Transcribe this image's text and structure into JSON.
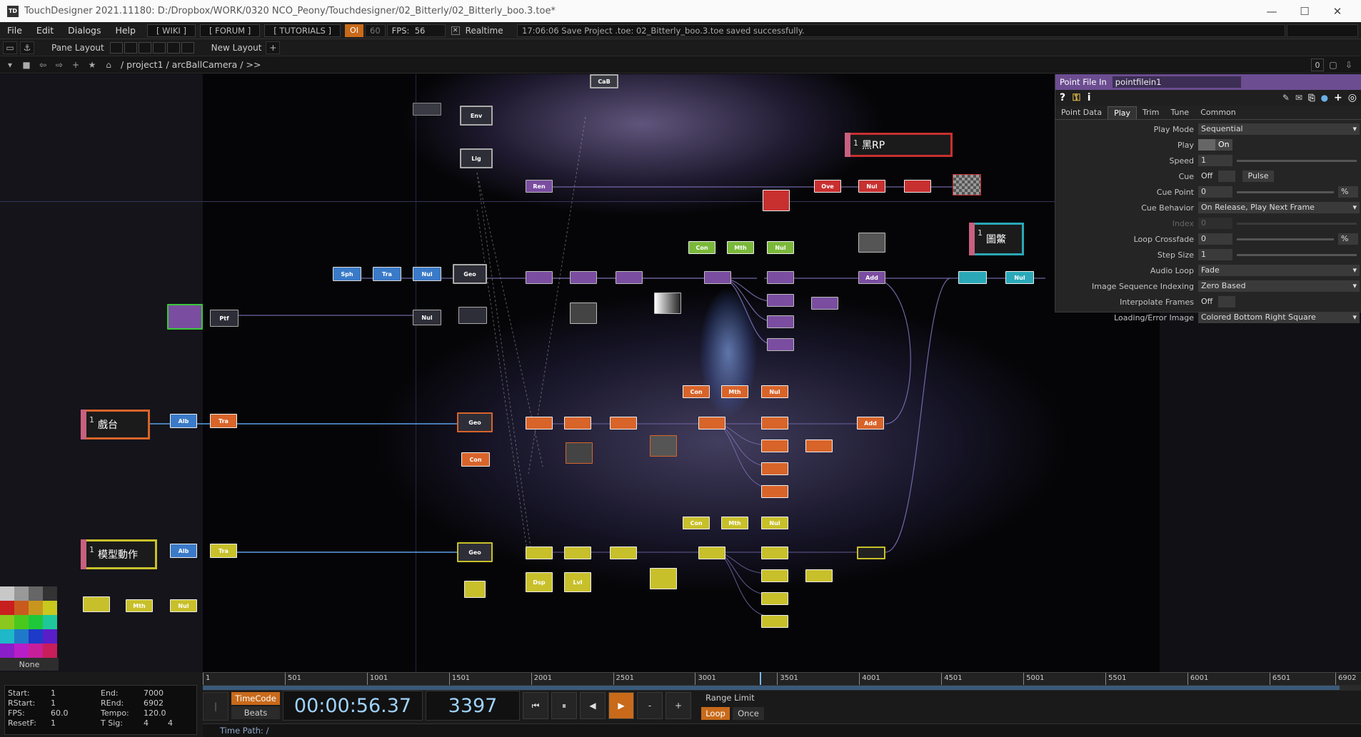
{
  "window": {
    "title": "TouchDesigner 2021.11180: D:/Dropbox/WORK/0320 NCO_Peony/Touchdesigner/02_Bitterly/02_Bitterly_boo.3.toe*",
    "app_badge": "TD",
    "minimize": "—",
    "maximize": "☐",
    "close": "✕"
  },
  "menu": {
    "items": [
      "File",
      "Edit",
      "Dialogs",
      "Help"
    ],
    "wiki": "[ WIKI ]",
    "forum": "[ FORUM ]",
    "tutorials": "[ TUTORIALS ]",
    "oi": "OI",
    "fps_target": "60",
    "fps_label": "FPS:",
    "fps_value": "56",
    "realtime_label": "Realtime",
    "realtime_check": "✕",
    "status_message": "17:06:06 Save Project .toe: 02_Bitterly_boo.3.toe saved successfully."
  },
  "toolbar": {
    "pane_layout": "Pane Layout",
    "new_layout": "New Layout",
    "add": "+"
  },
  "pathbar": {
    "path": "/ project1 / arcBallCamera / >>",
    "counter": "0"
  },
  "network": {
    "nodes": [
      {
        "id": "cab",
        "label": "CaB",
        "color": "#666a78"
      },
      {
        "id": "env",
        "label": "Env",
        "color": "#666a78"
      },
      {
        "id": "lig",
        "label": "Lig",
        "color": "#666a78"
      },
      {
        "id": "ren1",
        "label": "Ren",
        "color": "#7a4da0"
      },
      {
        "id": "ove",
        "label": "Ove",
        "color": "#c83030"
      },
      {
        "id": "nul_r1",
        "label": "Nul",
        "color": "#c83030"
      },
      {
        "id": "sph",
        "label": "Sph",
        "color": "#3a7ac8"
      },
      {
        "id": "tra1",
        "label": "Tra",
        "color": "#3a7ac8"
      },
      {
        "id": "nul_b1",
        "label": "Nul",
        "color": "#3a7ac8"
      },
      {
        "id": "geo1",
        "label": "Geo",
        "color": "#666a78"
      },
      {
        "id": "ptf",
        "label": "Ptf",
        "color": "#7a4da0"
      },
      {
        "id": "nul_p1",
        "label": "Nul",
        "color": "#7a4da0"
      },
      {
        "id": "con1",
        "label": "Con",
        "color": "#7ab83a"
      },
      {
        "id": "mth1",
        "label": "Mth",
        "color": "#7ab83a"
      },
      {
        "id": "nul_g1",
        "label": "Nul",
        "color": "#7ab83a"
      },
      {
        "id": "add1",
        "label": "Add",
        "color": "#7a4da0"
      },
      {
        "id": "nul_c1",
        "label": "Nul",
        "color": "#2aa8b8"
      },
      {
        "id": "alb1",
        "label": "Alb",
        "color": "#3a7ac8"
      },
      {
        "id": "tra2",
        "label": "Tra",
        "color": "#d8642a"
      },
      {
        "id": "geo2",
        "label": "Geo",
        "color": "#d8642a"
      },
      {
        "id": "con2",
        "label": "Con",
        "color": "#d8642a"
      },
      {
        "id": "con3",
        "label": "Con",
        "color": "#d8642a"
      },
      {
        "id": "mth2",
        "label": "Mth",
        "color": "#d8642a"
      },
      {
        "id": "nul_o1",
        "label": "Nul",
        "color": "#d8642a"
      },
      {
        "id": "add2",
        "label": "Add",
        "color": "#d8642a"
      },
      {
        "id": "alb2",
        "label": "Alb",
        "color": "#3a7ac8"
      },
      {
        "id": "tra3",
        "label": "Tra",
        "color": "#c8c02a"
      },
      {
        "id": "geo3",
        "label": "Geo",
        "color": "#c8c02a"
      },
      {
        "id": "con4",
        "label": "Con",
        "color": "#c8c02a"
      },
      {
        "id": "mth3",
        "label": "Mth",
        "color": "#c8c02a"
      },
      {
        "id": "nul_y1",
        "label": "Nul",
        "color": "#c8c02a"
      },
      {
        "id": "mth4",
        "label": "Mth",
        "color": "#c8c02a"
      },
      {
        "id": "nul_y2",
        "label": "Nul",
        "color": "#c8c02a"
      },
      {
        "id": "lvl",
        "label": "Lvl",
        "color": "#c8c02a"
      },
      {
        "id": "dsp",
        "label": "Dsp",
        "color": "#c8c02a"
      }
    ],
    "comps": [
      {
        "id": "rp",
        "num": "1",
        "label": "黑RP",
        "color": "#c83030"
      },
      {
        "id": "tujing",
        "num": "1",
        "label": "圖鱉",
        "color": "#2aa8b8"
      },
      {
        "id": "xitai",
        "num": "1",
        "label": "戲台",
        "color": "#d8642a"
      },
      {
        "id": "moxing",
        "num": "1",
        "label": "模型動作",
        "color": "#c8c02a"
      }
    ],
    "palette_none": "None"
  },
  "params": {
    "op_type": "Point File In",
    "op_name": "pointfilein1",
    "tabs": [
      "Point Data",
      "Play",
      "Trim",
      "Tune",
      "Common"
    ],
    "active_tab": "Play",
    "rows": [
      {
        "label": "Play Mode",
        "value": "Sequential"
      },
      {
        "label": "Play",
        "value": "On"
      },
      {
        "label": "Speed",
        "value": "1"
      },
      {
        "label": "Cue",
        "value": "Off",
        "extra": "Pulse"
      },
      {
        "label": "Cue Point",
        "value": "0",
        "extra": "%"
      },
      {
        "label": "Cue Behavior",
        "value": "On Release, Play Next Frame"
      },
      {
        "label": "Index",
        "value": "0"
      },
      {
        "label": "Loop Crossfade",
        "value": "0",
        "extra": "%"
      },
      {
        "label": "Step Size",
        "value": "1"
      },
      {
        "label": "Audio Loop",
        "value": "Fade"
      },
      {
        "label": "Image Sequence Indexing",
        "value": "Zero Based"
      },
      {
        "label": "Interpolate Frames",
        "value": "Off"
      },
      {
        "label": "Loading/Error Image",
        "value": "Colored Bottom Right Square"
      }
    ]
  },
  "timeline": {
    "ticks": [
      "1",
      "501",
      "1001",
      "1501",
      "2001",
      "2501",
      "3001",
      "3501",
      "4001",
      "4501",
      "5001",
      "5501",
      "6001",
      "6501",
      "6902"
    ],
    "start_label": "Start:",
    "start": "1",
    "end_label": "End:",
    "end": "7000",
    "rstart_label": "RStart:",
    "rstart": "1",
    "rend_label": "REnd:",
    "rend": "6902",
    "fps_label": "FPS:",
    "fps": "60.0",
    "tempo_label": "Tempo:",
    "tempo": "120.0",
    "resetf_label": "ResetF:",
    "resetf": "1",
    "tsig_label": "T Sig:",
    "tsig_a": "4",
    "tsig_b": "4",
    "timecode_btn": "TimeCode",
    "beats_btn": "Beats",
    "timecode": "00:00:56.37",
    "frame": "3397",
    "range_limit": "Range Limit",
    "loop": "Loop",
    "once": "Once",
    "time_path": "Time Path: /",
    "btn_start": "⏮",
    "btn_pause": "⏸",
    "btn_back": "◀",
    "btn_play": "▶",
    "btn_minus": "-",
    "btn_plus": "+",
    "playhead_frame": 3397
  }
}
